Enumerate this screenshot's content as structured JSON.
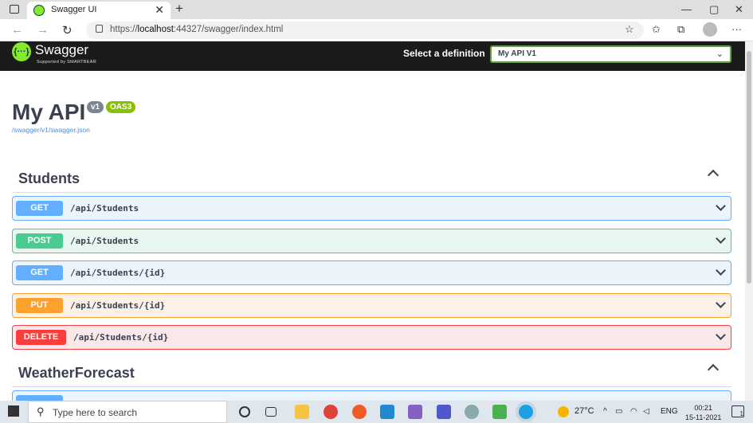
{
  "browser": {
    "tab_title": "Swagger UI",
    "new_tab": "+",
    "tab_close": "✕",
    "url_prefix": "https://",
    "url_host": "localhost",
    "url_rest": ":44327/swagger/index.html",
    "win_min": "—",
    "win_max": "▢",
    "win_close": "✕",
    "back": "←",
    "forward": "→",
    "reload": "↻",
    "fav_star": "☆",
    "favorites": "✩",
    "collections": "⧉",
    "menu": "···"
  },
  "swagger": {
    "brand": "Swagger",
    "brand_sub": "Supported by SMARTBEAR",
    "logo_glyph": "{···}",
    "select_label": "Select a definition",
    "select_value": "My API V1",
    "select_caret": "⌄"
  },
  "info": {
    "title": "My API",
    "version_badge": "v1",
    "oas_badge": "OAS3",
    "json_link": "/swagger/v1/swagger.json"
  },
  "tags": [
    {
      "name": "Students",
      "operations": [
        {
          "method": "GET",
          "path": "/api/Students",
          "style": "get"
        },
        {
          "method": "POST",
          "path": "/api/Students",
          "style": "post"
        },
        {
          "method": "GET",
          "path": "/api/Students/{id}",
          "style": "get"
        },
        {
          "method": "PUT",
          "path": "/api/Students/{id}",
          "style": "put"
        },
        {
          "method": "DELETE",
          "path": "/api/Students/{id}",
          "style": "del"
        }
      ]
    },
    {
      "name": "WeatherForecast",
      "operations": []
    }
  ],
  "colors": {
    "get": "#61affe",
    "post": "#49cc90",
    "put": "#fca130",
    "delete": "#f93e3e",
    "topbar": "#1b1b1b",
    "swagger_green": "#85ea2d"
  },
  "taskbar": {
    "search_placeholder": "Type here to search",
    "search_icon": "⚲",
    "weather": "27°C",
    "lang": "ENG",
    "time": "00:21",
    "date": "15-11-2021",
    "notification_count": "1"
  }
}
